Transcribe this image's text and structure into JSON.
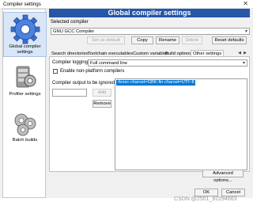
{
  "window": {
    "title": "Compiler settings",
    "close_glyph": "✕"
  },
  "sidebar": {
    "items": [
      {
        "label_line1": "Global compiler",
        "label_line2": "settings",
        "icon": "gear-icon",
        "selected": true
      },
      {
        "label_line1": "Profiler settings",
        "icon": "profiler-icon",
        "selected": false
      },
      {
        "label_line1": "Batch builds",
        "icon": "batch-builds-icon",
        "selected": false
      }
    ]
  },
  "header": {
    "banner": "Global compiler settings"
  },
  "compiler": {
    "section_label": "Selected compiler",
    "selected_value": "GNU GCC Compiler",
    "buttons": {
      "set_default": "Set as default",
      "copy": "Copy",
      "rename": "Rename",
      "delete": "Delete",
      "reset_defaults": "Reset defaults"
    }
  },
  "tabs": [
    {
      "label": "Search directories",
      "active": false
    },
    {
      "label": "Toolchain executables",
      "active": false
    },
    {
      "label": "Custom variables",
      "active": false
    },
    {
      "label": "Build options",
      "active": false
    },
    {
      "label": "Other settings",
      "active": true
    }
  ],
  "tab_scroll": {
    "left": "◀",
    "right": "▶"
  },
  "other_settings": {
    "logging_label": "Compiler logging:",
    "logging_value": "Full command line",
    "enable_nonplatform_label": "Enable non-platform compilers",
    "ignored_label": "Compiler output to be ignored:",
    "add_button": "Add",
    "remove_button": "Remove",
    "ignored_items": [
      "-fexec-charset=GBK-fin-charset=UTF-8"
    ],
    "advanced_button": "Advanced options..."
  },
  "footer": {
    "ok_button": "OK",
    "cancel_button": "Cancel"
  },
  "watermark": "CSDN @2501_92294663",
  "colors": {
    "banner_bg": "#2556a8",
    "selection": "#0078d7"
  }
}
